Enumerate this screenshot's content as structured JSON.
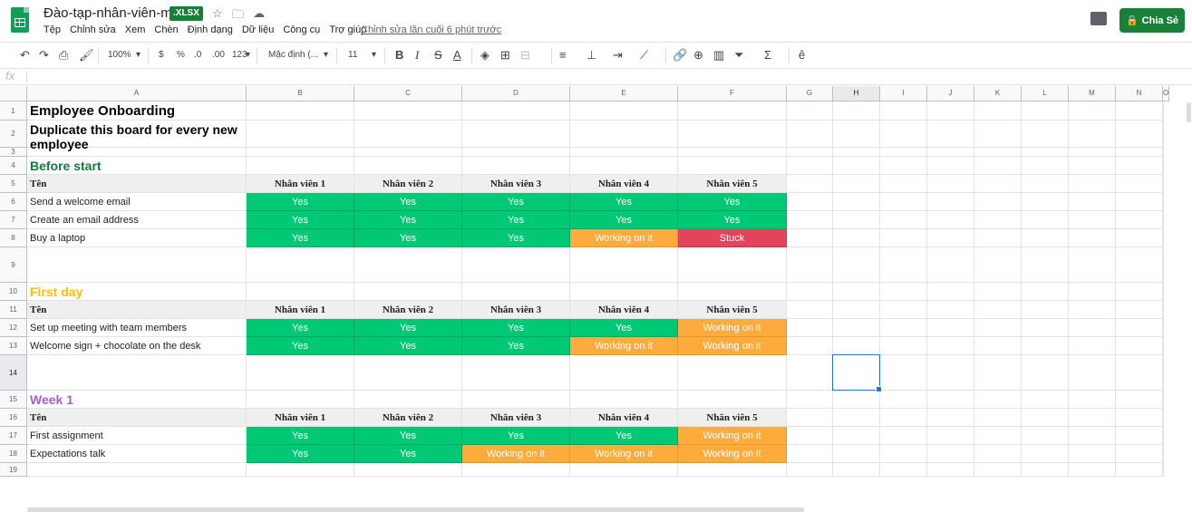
{
  "header": {
    "title": "Đào-tạp-nhân-viên-mới",
    "badge": ".XLSX",
    "last_edit": "Chỉnh sửa lần cuối 6 phút trước",
    "share": "Chia Sẻ",
    "menu": [
      "Tệp",
      "Chỉnh sửa",
      "Xem",
      "Chèn",
      "Định dạng",
      "Dữ liệu",
      "Công cụ",
      "Trợ giúp"
    ]
  },
  "toolbar": {
    "zoom": "100%",
    "currency": "$",
    "percent": "%",
    "dec_less": ".0",
    "dec_more": ".00",
    "numfmt": "123",
    "font": "Mặc định (...",
    "size": "11"
  },
  "formula": {
    "fx": "fx"
  },
  "columns": [
    "A",
    "B",
    "C",
    "D",
    "E",
    "F",
    "G",
    "H",
    "I",
    "J",
    "K",
    "L",
    "M",
    "N",
    "O"
  ],
  "rows": [
    "1",
    "2",
    "3",
    "4",
    "5",
    "6",
    "7",
    "8",
    "9",
    "10",
    "11",
    "12",
    "13",
    "14",
    "15",
    "16",
    "17",
    "18",
    "19"
  ],
  "sheet": {
    "title": "Employee Onboarding",
    "subtitle": "Duplicate this board for every new employee",
    "header_labels": [
      "Tên",
      "Nhân viên 1",
      "Nhân viên 2",
      "Nhân viên 3",
      "Nhân viên 4",
      "Nhân viên 5"
    ],
    "sections": [
      {
        "name": "Before start",
        "color": "#0f7b3f",
        "tasks": [
          {
            "task": "Send a welcome email",
            "status": [
              "Yes",
              "Yes",
              "Yes",
              "Yes",
              "Yes"
            ]
          },
          {
            "task": "Create an email address",
            "status": [
              "Yes",
              "Yes",
              "Yes",
              "Yes",
              "Yes"
            ]
          },
          {
            "task": "Buy a laptop",
            "status": [
              "Yes",
              "Yes",
              "Yes",
              "Working on it",
              "Stuck"
            ]
          }
        ]
      },
      {
        "name": "First day",
        "color": "#fbbc04",
        "tasks": [
          {
            "task": "Set up meeting with team members",
            "status": [
              "Yes",
              "Yes",
              "Yes",
              "Yes",
              "Working on it"
            ]
          },
          {
            "task": "Welcome sign + chocolate on the desk",
            "status": [
              "Yes",
              "Yes",
              "Yes",
              "Working on it",
              "Working on it"
            ]
          }
        ]
      },
      {
        "name": "Week 1",
        "color": "#a25ddc",
        "tasks": [
          {
            "task": "First assignment",
            "status": [
              "Yes",
              "Yes",
              "Yes",
              "Yes",
              "Working on it"
            ]
          },
          {
            "task": "Expectations talk",
            "status": [
              "Yes",
              "Yes",
              "Working on it",
              "Working on it",
              "Working on it"
            ]
          }
        ]
      }
    ]
  },
  "colors": {
    "yes": "#00c875",
    "working": "#fdab3d",
    "stuck": "#e2445c",
    "accent": "#188038"
  }
}
